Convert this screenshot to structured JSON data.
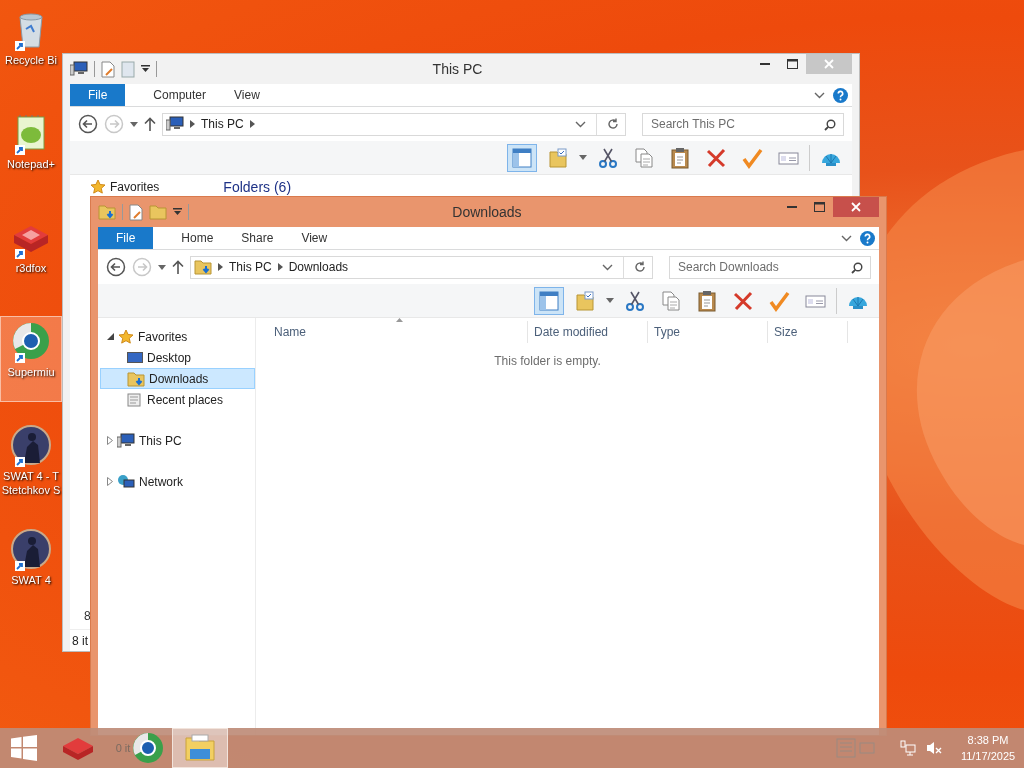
{
  "desktop": {
    "icons": [
      {
        "kind": "bin",
        "label": "Recycle Bi",
        "selected": false
      },
      {
        "kind": "notepad",
        "label": "Notepad+",
        "selected": false
      },
      {
        "kind": "boxes",
        "label": "r3dfox",
        "selected": false
      },
      {
        "kind": "globe",
        "label": "Supermiu",
        "selected": true
      },
      {
        "kind": "game",
        "label": "SWAT 4 - T Stetchkov S",
        "selected": false
      },
      {
        "kind": "game",
        "label": "SWAT 4",
        "selected": false
      }
    ]
  },
  "windows": [
    {
      "title": "This PC",
      "active": false,
      "kind": "pc",
      "tabs": [
        {
          "kind": "file",
          "label": "File"
        },
        {
          "kind": "tab",
          "label": "Computer"
        },
        {
          "kind": "tab",
          "label": "View"
        }
      ],
      "address": {
        "crumbs": [
          "This PC"
        ]
      },
      "search": {
        "placeholder": "Search This PC"
      },
      "content": {
        "kind": "peek",
        "favorites": "Favorites",
        "section": "Folders (6)",
        "count": "8",
        "status": "8 it"
      }
    },
    {
      "title": "Downloads",
      "active": true,
      "kind": "downloads",
      "tabs": [
        {
          "kind": "file",
          "label": "File"
        },
        {
          "kind": "tab",
          "label": "Home"
        },
        {
          "kind": "tab",
          "label": "Share"
        },
        {
          "kind": "tab",
          "label": "View"
        }
      ],
      "address": {
        "crumbs": [
          "This PC",
          "Downloads"
        ]
      },
      "search": {
        "placeholder": "Search Downloads"
      },
      "content": {
        "kind": "browser",
        "nav": [
          {
            "kind": "star",
            "label": "Favorites",
            "expanded": true,
            "selected": false,
            "children": [
              {
                "kind": "desktop",
                "label": "Desktop",
                "selected": false
              },
              {
                "kind": "downloads",
                "label": "Downloads",
                "selected": true
              },
              {
                "kind": "recent",
                "label": "Recent places",
                "selected": false
              }
            ]
          },
          {
            "kind": "pc",
            "label": "This PC",
            "expanded": false,
            "selected": false
          },
          {
            "kind": "network",
            "label": "Network",
            "expanded": false,
            "selected": false
          }
        ],
        "columns": [
          "Name",
          "Date modified",
          "Type",
          "Size"
        ],
        "empty": "This folder is empty."
      }
    }
  ],
  "taskbar": {
    "peek": "0 it",
    "time": "8:38 PM",
    "date": "11/17/2025"
  }
}
